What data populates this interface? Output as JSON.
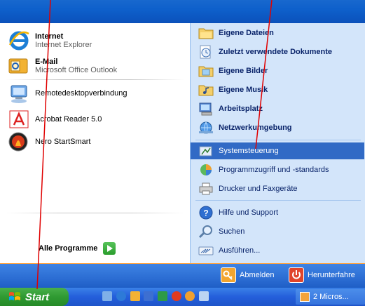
{
  "left_pinned": [
    {
      "title": "Internet",
      "subtitle": "Internet Explorer",
      "icon": "internet-explorer-icon"
    },
    {
      "title": "E-Mail",
      "subtitle": "Microsoft Office Outlook",
      "icon": "outlook-icon"
    }
  ],
  "left_recent": [
    {
      "label": "Remotedesktopverbindung",
      "icon": "remote-desktop-icon"
    },
    {
      "label": "Acrobat Reader 5.0",
      "icon": "acrobat-icon"
    },
    {
      "label": "Nero StartSmart",
      "icon": "nero-icon"
    }
  ],
  "all_programs_label": "Alle Programme",
  "right_items": [
    {
      "label": "Eigene Dateien",
      "icon": "folder-icon",
      "bold": true
    },
    {
      "label": "Zuletzt verwendete Dokumente",
      "icon": "recent-docs-icon",
      "bold": true
    },
    {
      "label": "Eigene Bilder",
      "icon": "pictures-folder-icon",
      "bold": true
    },
    {
      "label": "Eigene Musik",
      "icon": "music-folder-icon",
      "bold": true
    },
    {
      "label": "Arbeitsplatz",
      "icon": "my-computer-icon",
      "bold": true
    },
    {
      "label": "Netzwerkumgebung",
      "icon": "network-icon",
      "bold": true
    },
    {
      "label": "Systemsteuerung",
      "icon": "control-panel-icon",
      "selected": true
    },
    {
      "label": "Programmzugriff und -standards",
      "icon": "program-access-icon"
    },
    {
      "label": "Drucker und Faxgeräte",
      "icon": "printer-icon"
    },
    {
      "label": "Hilfe und Support",
      "icon": "help-icon"
    },
    {
      "label": "Suchen",
      "icon": "search-icon"
    },
    {
      "label": "Ausführen...",
      "icon": "run-icon"
    }
  ],
  "footer": {
    "logoff_label": "Abmelden",
    "shutdown_label": "Herunterfahre"
  },
  "taskbar": {
    "start_label": "Start",
    "task_label": "2 Micros..."
  },
  "colors": {
    "header_blue": "#0e60cb",
    "right_panel": "#d3e5fa",
    "selection": "#316ac5",
    "start_green": "#2f9a32",
    "annotation_red": "#e00000"
  }
}
